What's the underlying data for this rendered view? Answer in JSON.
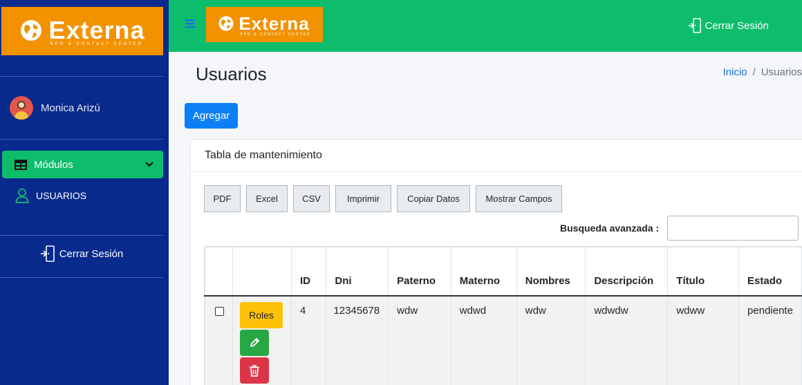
{
  "brand": {
    "name": "Externa",
    "tagline": "BPO & CONTACT CENTER"
  },
  "sidebar": {
    "user_name": "Monica Arizú",
    "modules_label": "Módulos",
    "users_label": "USUARIOS",
    "logout_label": "Cerrar Sesión"
  },
  "header": {
    "logout_label": "Cerrar Sesión"
  },
  "page": {
    "title": "Usuarios",
    "breadcrumb_home": "Inicio",
    "breadcrumb_sep": "/",
    "breadcrumb_current": "Usuarios",
    "add_button": "Agregar"
  },
  "card": {
    "title": "Tabla de mantenimiento",
    "export_buttons": [
      "PDF",
      "Excel",
      "CSV",
      "Imprimir",
      "Copiar Datos",
      "Mostrar Campos"
    ],
    "search_label": "Busqueda avanzada :",
    "search_value": ""
  },
  "table": {
    "headers": [
      "",
      "",
      "ID",
      "Dni",
      "Paterno",
      "Materno",
      "Nombres",
      "Descripción",
      "Título",
      "Estado"
    ],
    "rows": [
      {
        "checked": false,
        "roles_label": "Roles",
        "id": "4",
        "dni": "12345678",
        "paterno": "wdw",
        "materno": "wdwd",
        "nombres": "wdw",
        "descripcion": "wdwdw",
        "titulo": "wdww",
        "estado": "pendiente"
      }
    ]
  },
  "colors": {
    "sidebar_bg": "#072a8c",
    "topbar_bg": "#0ebd6c",
    "logo_bg": "#f39200",
    "primary": "#0d7ff5",
    "warning": "#ffc107",
    "success": "#28a745",
    "danger": "#dc3545"
  }
}
